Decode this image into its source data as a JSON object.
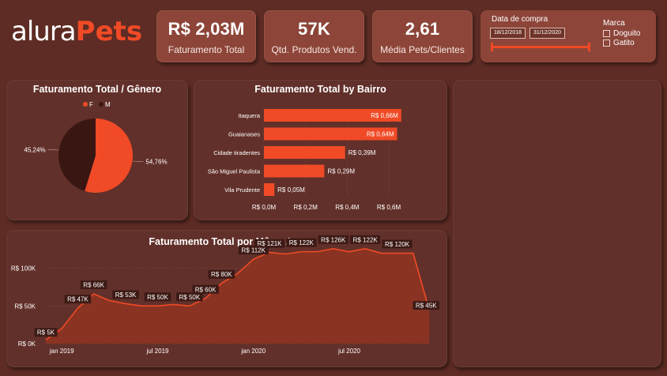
{
  "logo": {
    "part1": "alura",
    "part2": "Pets"
  },
  "kpis": [
    {
      "value": "R$ 2,03M",
      "label": "Faturamento Total"
    },
    {
      "value": "57K",
      "label": "Qtd. Produtos Vend."
    },
    {
      "value": "2,61",
      "label": "Média Pets/Clientes"
    }
  ],
  "filters": {
    "date_title": "Data de compra",
    "date_start": "18/12/2018",
    "date_end": "31/12/2020",
    "brand_title": "Marca",
    "brands": [
      {
        "label": "Doguito",
        "checked": false
      },
      {
        "label": "Gatito",
        "checked": false
      }
    ]
  },
  "colors": {
    "accent": "#f04a26",
    "dark_slice": "#3a1612",
    "panel": "#62302a",
    "area_fill": "#8a3322"
  },
  "chart_data": [
    {
      "type": "pie",
      "title": "Faturamento Total / Gênero",
      "labels": [
        "F",
        "M"
      ],
      "values": [
        54.76,
        45.24
      ],
      "value_labels": [
        "54,76%",
        "45,24%"
      ],
      "colors": [
        "#f04a26",
        "#3a1612"
      ],
      "legend": "top-center"
    },
    {
      "type": "bar",
      "orientation": "horizontal",
      "title": "Faturamento Total by Bairro",
      "categories": [
        "Itaquera",
        "Guaianases",
        "Cidade tiradentes",
        "São Miguel Paulista",
        "Vila Prudente"
      ],
      "values": [
        0.66,
        0.64,
        0.39,
        0.29,
        0.05
      ],
      "value_labels": [
        "R$ 0,66M",
        "R$ 0,64M",
        "R$ 0,39M",
        "R$ 0,29M",
        "R$ 0,05M"
      ],
      "xticks": [
        "R$ 0,0M",
        "R$ 0,2M",
        "R$ 0,4M",
        "R$ 0,6M"
      ],
      "xlim": [
        0,
        0.6
      ],
      "grid": true
    },
    {
      "type": "area",
      "title": "Faturamento Total por Mês e Ano",
      "x": [
        "2018-12",
        "2019-01",
        "2019-02",
        "2019-03",
        "2019-04",
        "2019-05",
        "2019-06",
        "2019-07",
        "2019-08",
        "2019-09",
        "2019-10",
        "2019-11",
        "2019-12",
        "2020-01",
        "2020-02",
        "2020-03",
        "2020-04",
        "2020-05",
        "2020-06",
        "2020-07",
        "2020-08",
        "2020-09",
        "2020-10",
        "2020-11",
        "2020-12"
      ],
      "values": [
        5,
        20,
        47,
        66,
        57,
        53,
        50,
        50,
        52,
        50,
        60,
        80,
        93,
        112,
        121,
        119,
        122,
        122,
        126,
        122,
        126,
        120,
        120,
        120,
        45
      ],
      "data_labels": [
        {
          "i": 0,
          "text": "R$ 5K"
        },
        {
          "i": 2,
          "text": "R$ 47K"
        },
        {
          "i": 3,
          "text": "R$ 66K"
        },
        {
          "i": 5,
          "text": "R$ 53K"
        },
        {
          "i": 7,
          "text": "R$ 50K"
        },
        {
          "i": 9,
          "text": "R$ 50K"
        },
        {
          "i": 10,
          "text": "R$ 60K"
        },
        {
          "i": 11,
          "text": "R$ 80K"
        },
        {
          "i": 13,
          "text": "R$ 112K"
        },
        {
          "i": 14,
          "text": "R$ 121K"
        },
        {
          "i": 16,
          "text": "R$ 122K"
        },
        {
          "i": 18,
          "text": "R$ 126K"
        },
        {
          "i": 20,
          "text": "R$ 122K"
        },
        {
          "i": 22,
          "text": "R$ 120K"
        },
        {
          "i": 24,
          "text": "R$ 45K"
        }
      ],
      "yticks": [
        {
          "v": 0,
          "text": "R$ 0K"
        },
        {
          "v": 50,
          "text": "R$ 50K"
        },
        {
          "v": 100,
          "text": "R$ 100K"
        }
      ],
      "xticks": [
        {
          "i": 1,
          "text": "jan 2019"
        },
        {
          "i": 7,
          "text": "jul 2019"
        },
        {
          "i": 13,
          "text": "jan 2020"
        },
        {
          "i": 19,
          "text": "jul 2020"
        }
      ],
      "ylim": [
        0,
        130
      ],
      "grid": true
    }
  ]
}
